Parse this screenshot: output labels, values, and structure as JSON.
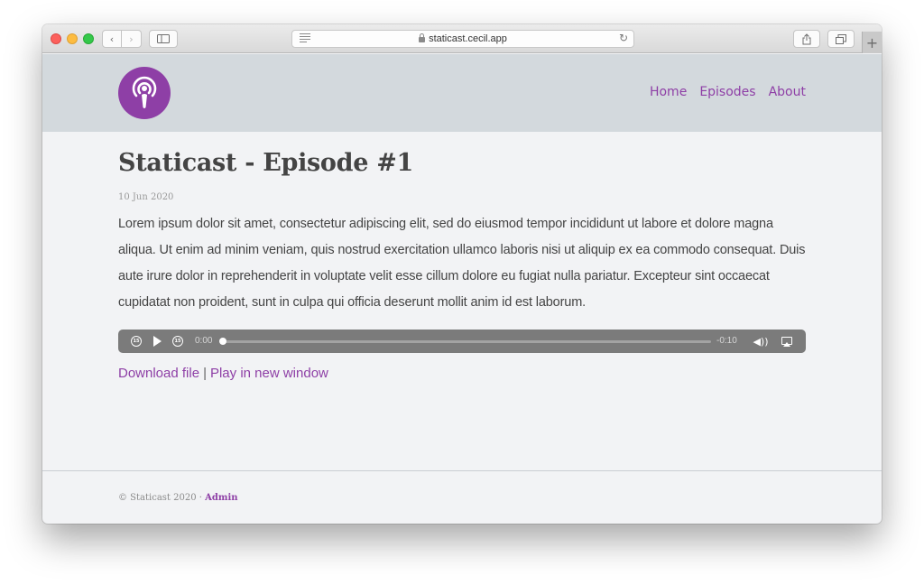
{
  "browser": {
    "url": "staticast.cecil.app"
  },
  "site": {
    "nav": [
      {
        "label": "Home"
      },
      {
        "label": "Episodes"
      },
      {
        "label": "About"
      }
    ]
  },
  "episode": {
    "title": "Staticast - Episode #1",
    "date": "10 Jun 2020",
    "body": "Lorem ipsum dolor sit amet, consectetur adipiscing elit, sed do eiusmod tempor incididunt ut labore et dolore magna aliqua. Ut enim ad minim veniam, quis nostrud exercitation ullamco laboris nisi ut aliquip ex ea commodo consequat. Duis aute irure dolor in reprehenderit in voluptate velit esse cillum dolore eu fugiat nulla pariatur. Excepteur sint occaecat cupidatat non proident, sunt in culpa qui officia deserunt mollit anim id est laborum."
  },
  "player": {
    "skip_back_label": "15",
    "skip_forward_label": "15",
    "current_time": "0:00",
    "remaining_time": "-0:10",
    "progress": 0
  },
  "links": {
    "download": "Download file",
    "separator": "|",
    "popout": "Play in new window"
  },
  "footer": {
    "copyright": "© Staticast 2020 · ",
    "admin": "Admin"
  },
  "colors": {
    "accent": "#8e3fa6",
    "header_bg": "#d3d9dd",
    "page_bg": "#f2f3f5",
    "player_bg": "#7b7b7b"
  },
  "icons": {
    "logo": "podcast-icon",
    "share": "share-icon",
    "tabs": "tabs-icon",
    "reload": "reload-icon"
  }
}
